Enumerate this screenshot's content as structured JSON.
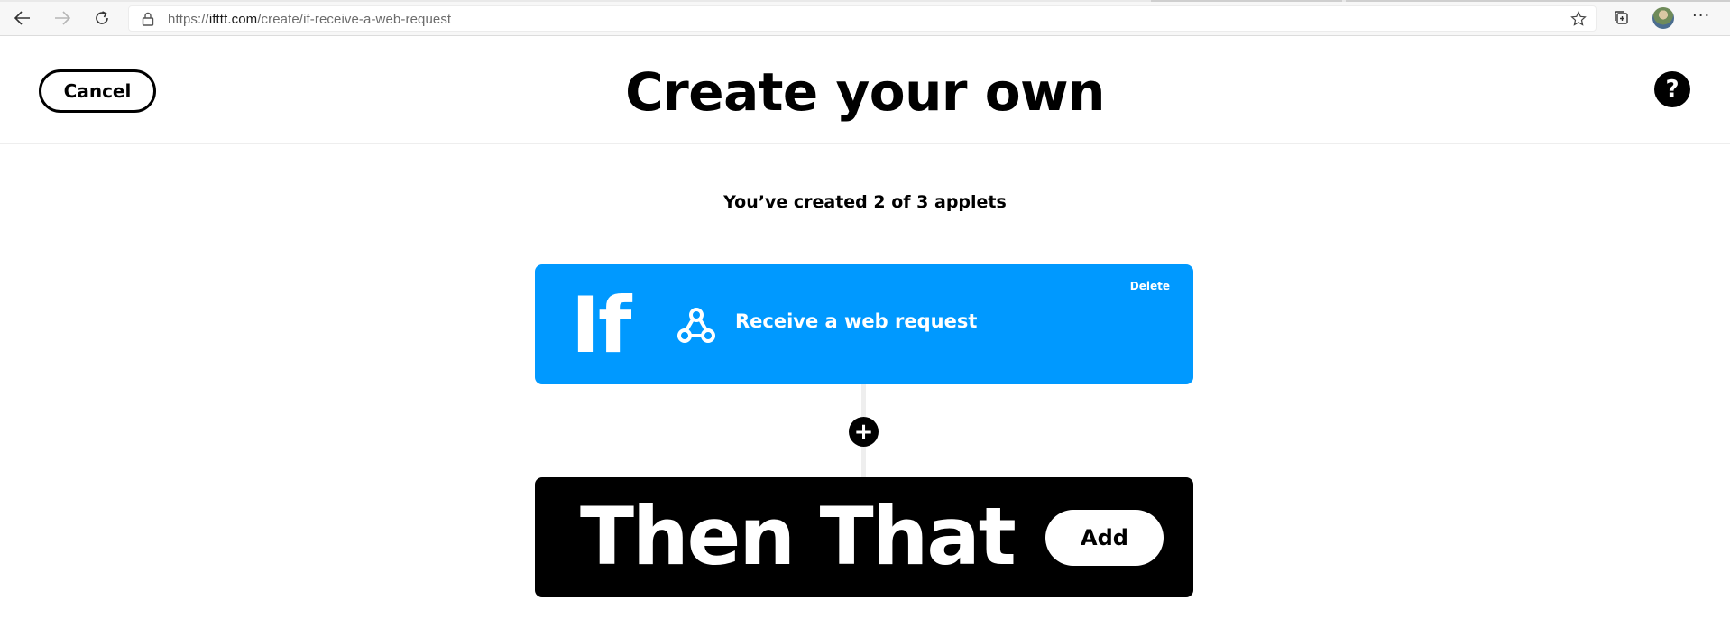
{
  "browser": {
    "url_scheme": "https://",
    "url_host": "ifttt.com",
    "url_path": "/create/if-receive-a-web-request",
    "icons": [
      "back-arrow-icon",
      "forward-arrow-icon",
      "refresh-icon",
      "lock-icon",
      "favorite-star-icon",
      "collections-icon",
      "profile-avatar",
      "more-menu-icon"
    ],
    "more_label": "···"
  },
  "header": {
    "cancel_label": "Cancel",
    "title": "Create your own",
    "help_label": "?"
  },
  "quota_text": "You’ve created 2 of 3 applets",
  "if_card": {
    "keyword": "If",
    "trigger_label": "Receive a web request",
    "delete_label": "Delete",
    "icon": "webhook-icon",
    "color": "#0099ff"
  },
  "connector": {
    "plus_label": "+"
  },
  "then_card": {
    "keyword": "Then That",
    "add_label": "Add",
    "color": "#000000"
  }
}
